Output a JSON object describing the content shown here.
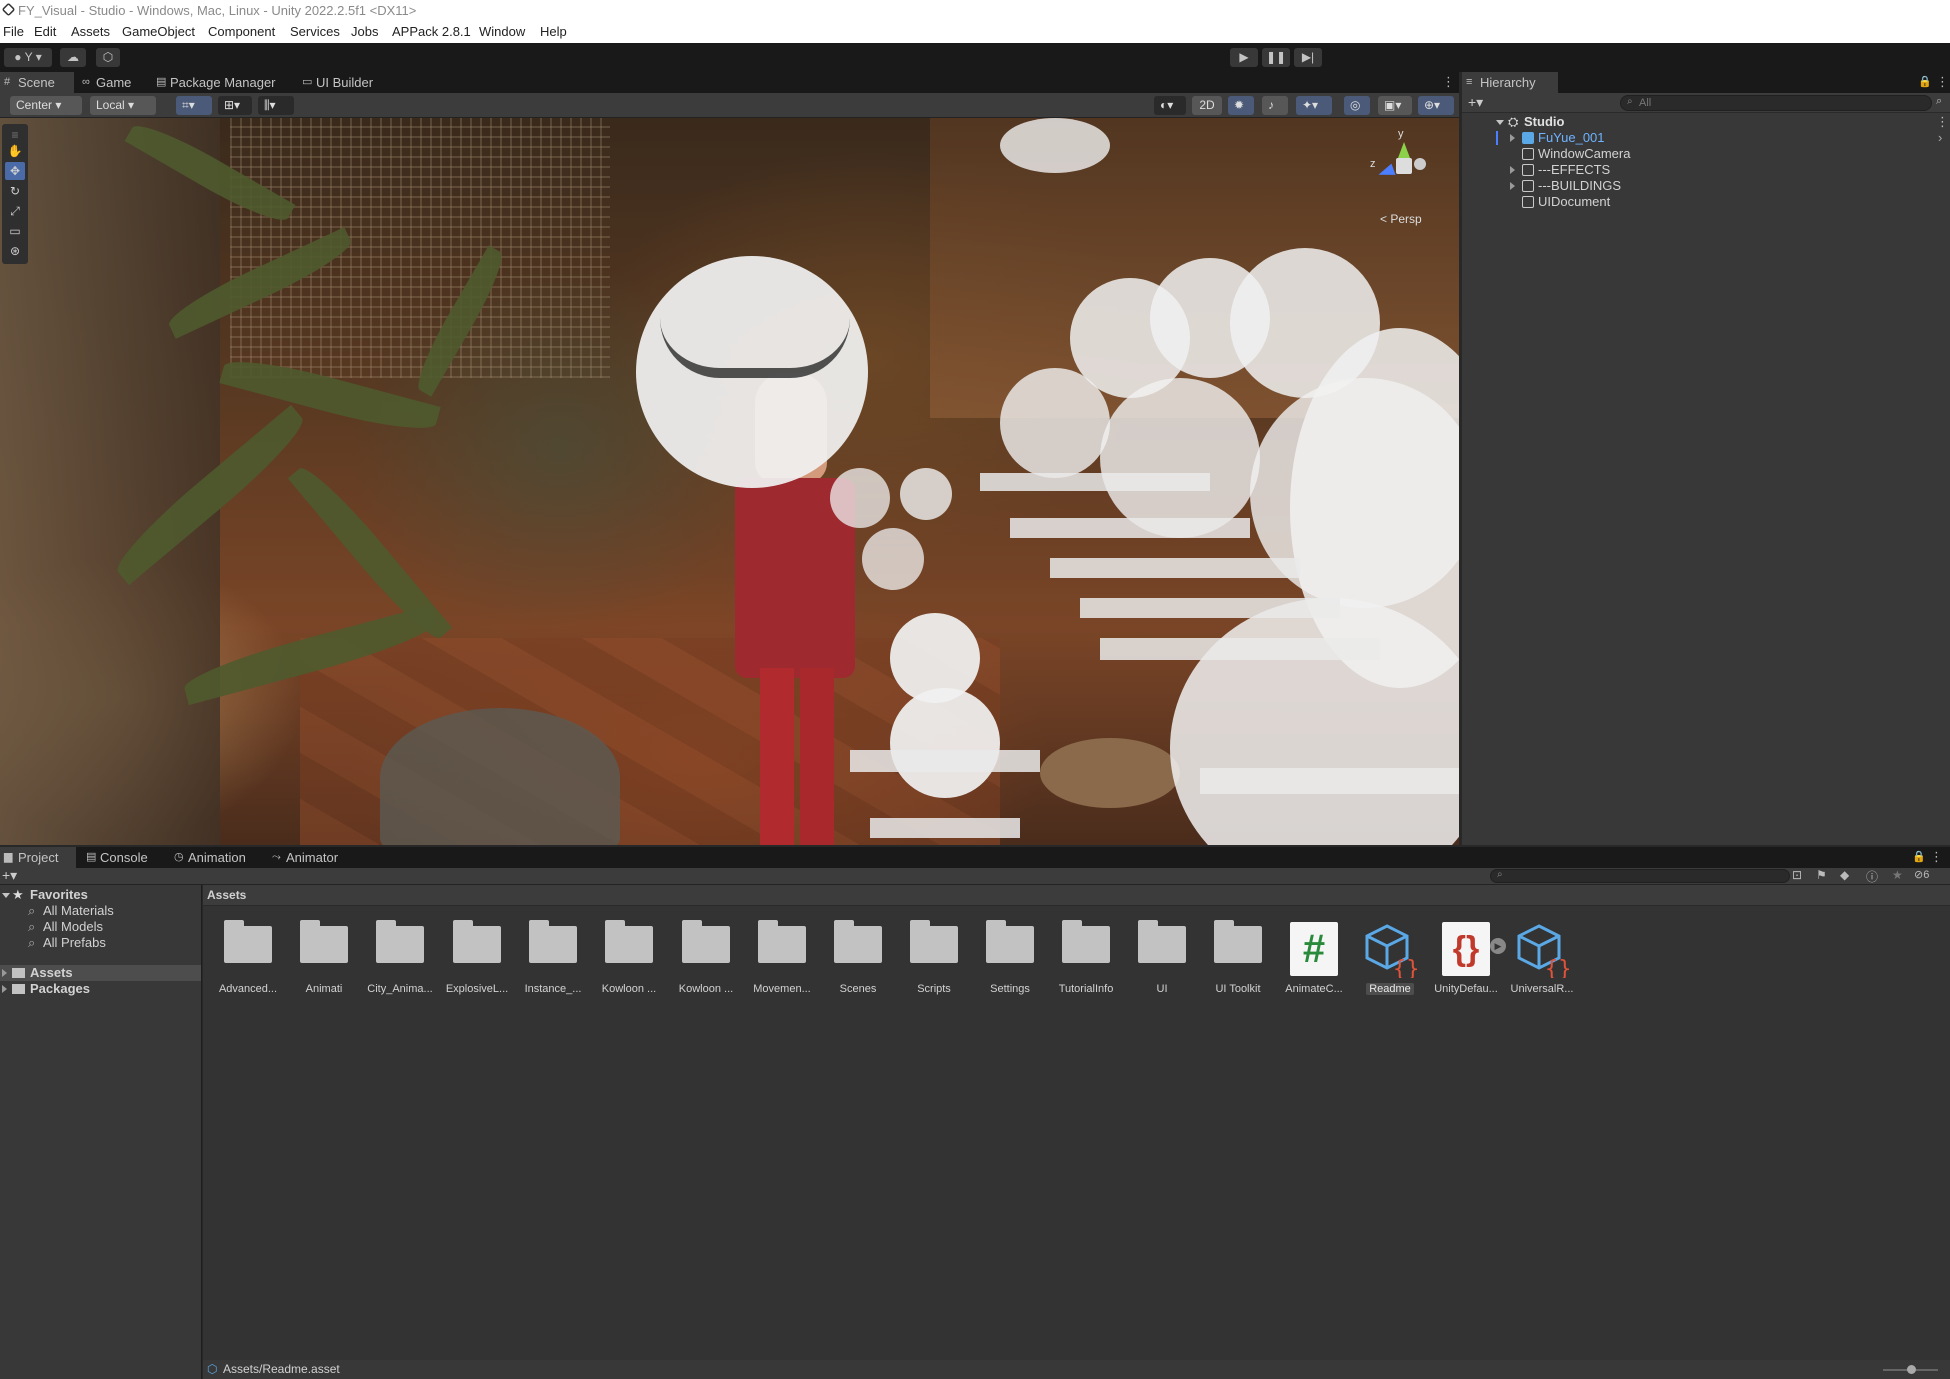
{
  "window": {
    "title": "FY_Visual - Studio - Windows, Mac, Linux - Unity 2022.2.5f1 <DX11>"
  },
  "menu": [
    "File",
    "Edit",
    "Assets",
    "GameObject",
    "Component",
    "Services",
    "Jobs",
    "APPack 2.8.1",
    "Window",
    "Help"
  ],
  "toolbar": {
    "account_label": "Y",
    "play_icon": "play-icon",
    "pause_icon": "pause-icon",
    "step_icon": "step-icon"
  },
  "top_tabs": {
    "scene": "Scene",
    "game": "Game",
    "package_manager": "Package Manager",
    "ui_builder": "UI Builder"
  },
  "scene_toolbar": {
    "pivot": "Center",
    "space": "Local",
    "mode_2d": "2D"
  },
  "gizmo": {
    "y_axis": "y",
    "z_axis": "z",
    "projection": "Persp"
  },
  "hierarchy": {
    "tab": "Hierarchy",
    "search_placeholder": "All",
    "scene": "Studio",
    "items": [
      "FuYue_001",
      "WindowCamera",
      "---EFFECTS",
      "---BUILDINGS",
      "UIDocument"
    ]
  },
  "bottom_tabs": {
    "project": "Project",
    "console": "Console",
    "animation": "Animation",
    "animator": "Animator"
  },
  "project": {
    "favorites": "Favorites",
    "favorite_items": [
      "All Materials",
      "All Models",
      "All Prefabs"
    ],
    "roots": [
      "Assets",
      "Packages"
    ],
    "breadcrumb": "Assets",
    "hidden_count": "6",
    "assets": [
      {
        "label": "Advanced...",
        "kind": "folder"
      },
      {
        "label": "Animati",
        "kind": "folder"
      },
      {
        "label": "City_Anima...",
        "kind": "folder"
      },
      {
        "label": "ExplosiveL...",
        "kind": "folder"
      },
      {
        "label": "Instance_...",
        "kind": "folder"
      },
      {
        "label": "Kowloon ...",
        "kind": "folder"
      },
      {
        "label": "Kowloon ...",
        "kind": "folder"
      },
      {
        "label": "Movemen...",
        "kind": "folder"
      },
      {
        "label": "Scenes",
        "kind": "folder"
      },
      {
        "label": "Scripts",
        "kind": "folder"
      },
      {
        "label": "Settings",
        "kind": "folder"
      },
      {
        "label": "TutorialInfo",
        "kind": "folder"
      },
      {
        "label": "UI",
        "kind": "folder"
      },
      {
        "label": "UI Toolkit",
        "kind": "folder"
      },
      {
        "label": "AnimateC...",
        "kind": "script"
      },
      {
        "label": "Readme",
        "kind": "asset"
      },
      {
        "label": "UnityDefau...",
        "kind": "json"
      },
      {
        "label": "UniversalR...",
        "kind": "asset"
      }
    ],
    "status_path": "Assets/Readme.asset"
  },
  "colors": {
    "accent_blue": "#4c7fff",
    "prefab_blue": "#5ba8e6",
    "script_green": "#2a8a3c",
    "json_red": "#c0392b"
  }
}
